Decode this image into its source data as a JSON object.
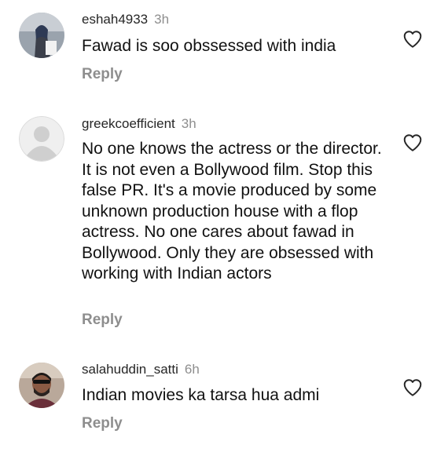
{
  "comments": [
    {
      "username": "eshah4933",
      "time": "3h",
      "text": "Fawad is soo obssessed with india",
      "reply_label": "Reply",
      "avatar_icon": "user-photo-avatar"
    },
    {
      "username": "greekcoefficient",
      "time": "3h",
      "text": "No one knows the actress or the director. It is not even a Bollywood film. Stop this false PR. It's a movie produced by some unknown production house with a flop actress. No one cares about fawad in Bollywood. Only they are obsessed with working with Indian actors",
      "reply_label": "Reply",
      "avatar_icon": "default-profile-avatar"
    },
    {
      "username": "salahuddin_satti",
      "time": "6h",
      "text": "Indian movies ka tarsa hua admi",
      "reply_label": "Reply",
      "avatar_icon": "user-photo-avatar"
    }
  ],
  "icons": {
    "like": "heart-outline-icon"
  },
  "colors": {
    "username": "#262626",
    "meta": "#8e8e8e",
    "text": "#111111"
  }
}
